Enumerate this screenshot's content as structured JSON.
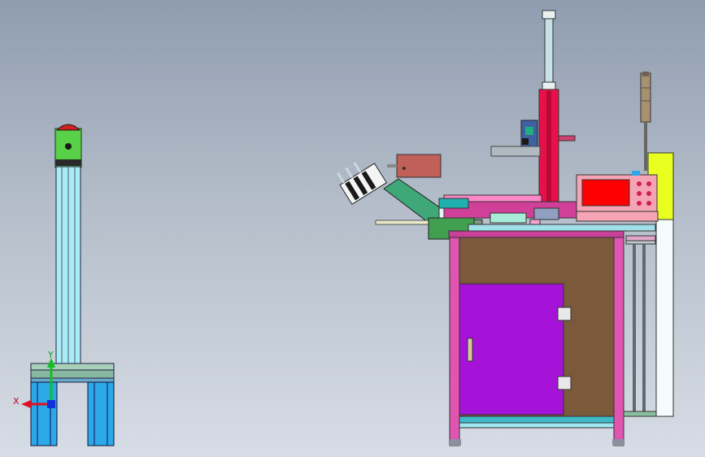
{
  "viewport": {
    "background_top": "#8f9db0",
    "background_bottom": "#d7dde6"
  },
  "triad": {
    "x_label": "X",
    "y_label": "Y",
    "x_color": "#e01020",
    "y_color": "#10c020",
    "z_color": "#1030e0"
  },
  "colors": {
    "frame_pink": "#e055b0",
    "cabinet_brown": "#7a5a3a",
    "door_purple": "#a512d8",
    "column_red": "#e8104a",
    "panel_pink": "#f4a4b4",
    "screen_red": "#ff0000",
    "side_yellow": "#e8ff20",
    "profile_cyan": "#a8ecf4",
    "leg_blue": "#2aa8e8",
    "bracket_green": "#58d048",
    "motor_green": "#40a050",
    "block_brown": "#c06058"
  }
}
